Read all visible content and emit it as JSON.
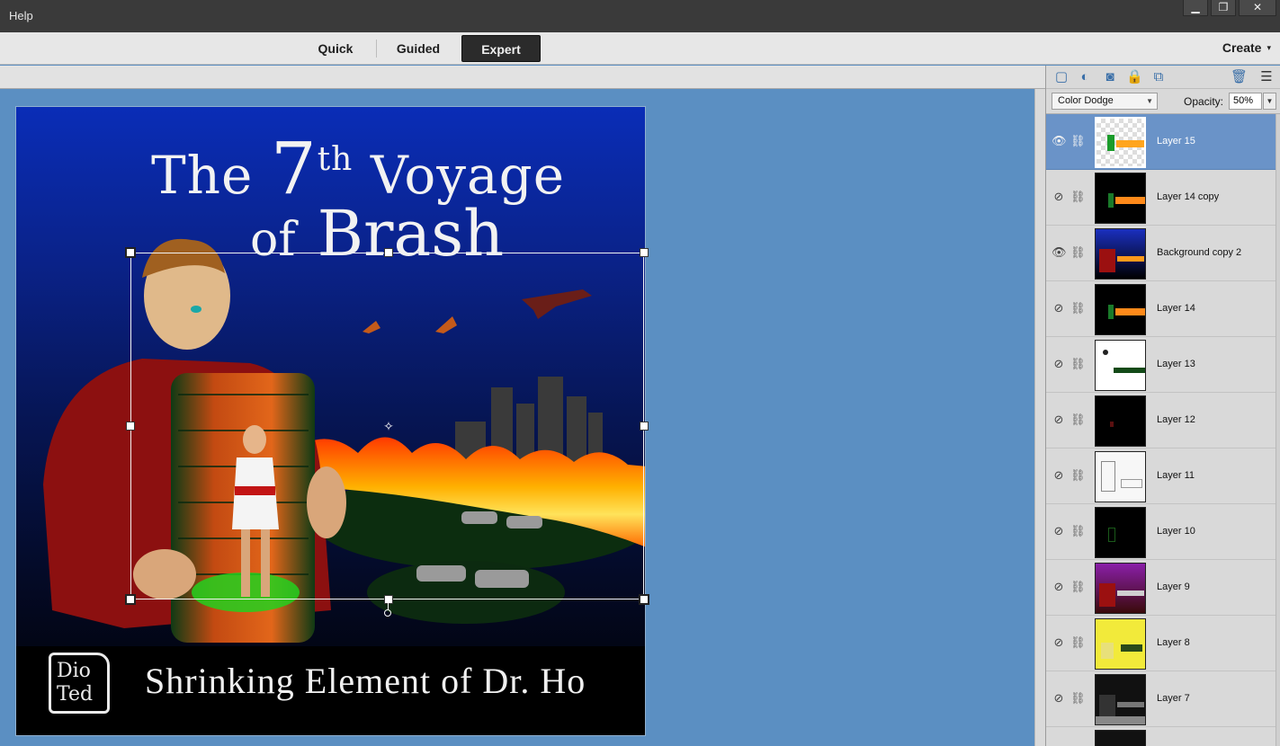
{
  "menu": {
    "help": "Help"
  },
  "window_buttons": {
    "minimize": "▁",
    "restore": "❐",
    "close": "✕"
  },
  "modes": [
    {
      "label": "Quick",
      "active": false
    },
    {
      "label": "Guided",
      "active": false
    },
    {
      "label": "Expert",
      "active": true
    }
  ],
  "create": {
    "label": "Create",
    "caret": "▾"
  },
  "artwork": {
    "title_the": "The",
    "title_7": "7",
    "title_th": "th",
    "title_voyage": "Voyage",
    "title_of": "of",
    "title_brash": "Brash",
    "logo_text": "Dio Ted",
    "subtitle": "Shrinking Element of Dr. Ho"
  },
  "layers_panel": {
    "tool_icons": [
      "new-layer-icon",
      "adjustment-layer-icon",
      "layer-mask-icon",
      "lock-icon",
      "lock-transparency-icon",
      "trash-icon",
      "panel-menu-icon"
    ],
    "blend_mode": "Color Dodge",
    "opacity_label": "Opacity:",
    "opacity_value": "50%",
    "layers": [
      {
        "name": "Layer 15",
        "visible": true,
        "selected": true
      },
      {
        "name": "Layer 14 copy",
        "visible": false,
        "selected": false
      },
      {
        "name": "Background copy 2",
        "visible": true,
        "selected": false
      },
      {
        "name": "Layer 14",
        "visible": false,
        "selected": false
      },
      {
        "name": "Layer 13",
        "visible": false,
        "selected": false
      },
      {
        "name": "Layer 12",
        "visible": false,
        "selected": false
      },
      {
        "name": "Layer 11",
        "visible": false,
        "selected": false
      },
      {
        "name": "Layer 10",
        "visible": false,
        "selected": false
      },
      {
        "name": "Layer 9",
        "visible": false,
        "selected": false
      },
      {
        "name": "Layer 8",
        "visible": false,
        "selected": false
      },
      {
        "name": "Layer 7",
        "visible": false,
        "selected": false
      },
      {
        "name": "",
        "visible": false,
        "selected": false
      }
    ]
  }
}
